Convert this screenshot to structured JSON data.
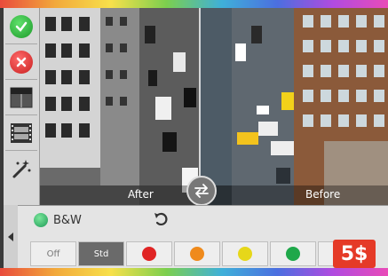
{
  "side_buttons": [
    {
      "name": "apply-button"
    },
    {
      "name": "cancel-button"
    },
    {
      "name": "compare-view-button"
    },
    {
      "name": "filmstrip-button"
    },
    {
      "name": "auto-enhance-button"
    }
  ],
  "photo": {
    "after_label": "After",
    "before_label": "Before"
  },
  "filter": {
    "name": "B&W"
  },
  "presets": [
    {
      "label": "Off"
    },
    {
      "label": "Std"
    }
  ],
  "color_presets": [
    "#e02424",
    "#ef8a1c",
    "#e6d71a",
    "#1fa84a",
    "#3a55c8"
  ],
  "logo": {
    "text": "5$"
  }
}
